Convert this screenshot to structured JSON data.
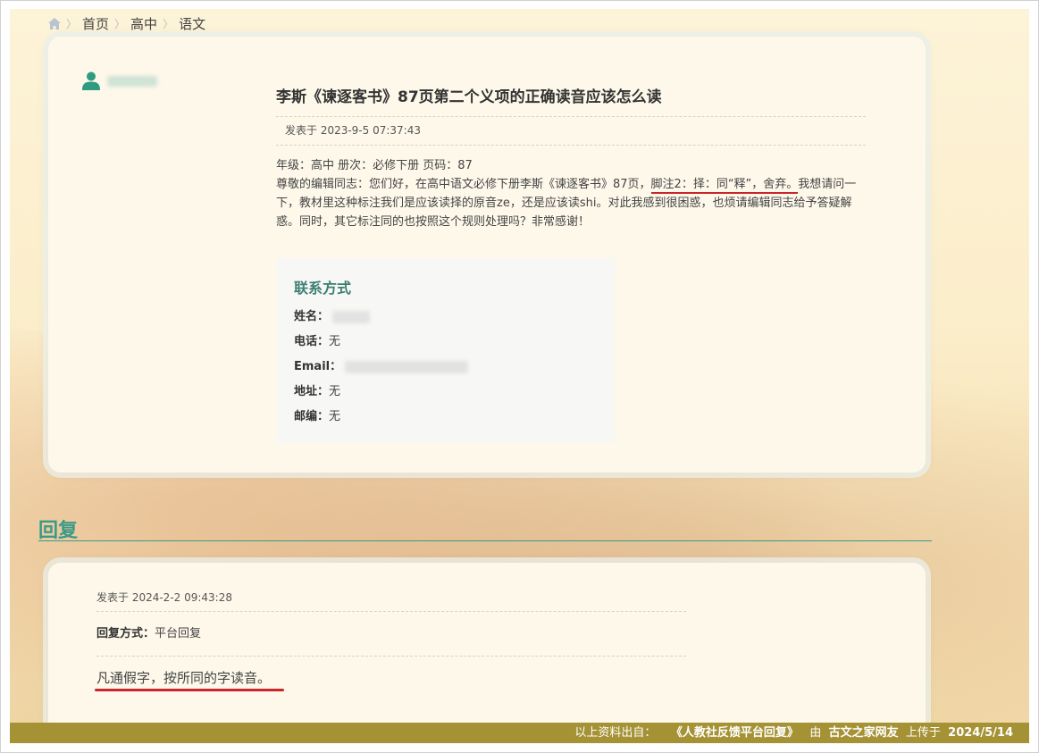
{
  "breadcrumb": {
    "home_icon": "home-icon",
    "items": [
      "首页",
      "高中",
      "语文"
    ]
  },
  "post": {
    "user_icon": "user-icon",
    "title": "李斯《谏逐客书》87页第二个义项的正确读音应该怎么读",
    "posted_at": "发表于 2023-9-5 07:37:43",
    "info_line": "年级：高中   册次：必修下册   页码：87",
    "body_before": "尊敬的编辑同志：您们好，在高中语文必修下册李斯《谏逐客书》87页，",
    "body_highlight": "脚注2：择：同“释”，舍弃。",
    "body_after": "我想请问一下，教材里这种标注我们是应该读择的原音ze，还是应该读shi。对此我感到很困惑，也烦请编辑同志给予答疑解惑。同时，其它标注同的也按照这个规则处理吗？非常感谢！"
  },
  "contact": {
    "title": "联系方式",
    "name_label": "姓名：",
    "phone_label": "电话：",
    "phone_value": "无",
    "email_label": "Email：",
    "address_label": "地址：",
    "address_value": "无",
    "zip_label": "邮编：",
    "zip_value": "无"
  },
  "reply": {
    "heading": "回复",
    "posted_at": "发表于 2024-2-2 09:43:28",
    "method_label": "回复方式：",
    "method_value": "平台回复",
    "text": "凡通假字，按所同的字读音。"
  },
  "footer": {
    "prefix": "以上资料出自：",
    "source": "《人教社反馈平台回复》",
    "by": "由",
    "uploader": "古文之家网友",
    "uploaded_on": "上传于",
    "date": "2024/5/14"
  },
  "colors": {
    "accent_teal": "#3a9a88",
    "footer_bar": "#a59234",
    "highlight_red": "#c9262c"
  }
}
